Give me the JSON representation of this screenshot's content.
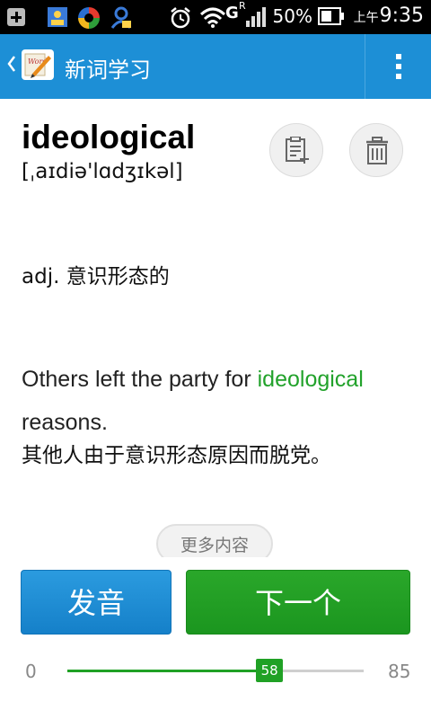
{
  "status_bar": {
    "network_label": "G",
    "roaming_label": "R",
    "battery_percent": "50%",
    "ampm": "上午",
    "time": "9:35"
  },
  "app_bar": {
    "title": "新词学习"
  },
  "word": {
    "headword": "ideological",
    "phonetic": "[ˌaɪdiə'lɑdʒɪkəl]",
    "definition": "adj. 意识形态的",
    "example_before": "Others left the party for ",
    "example_highlight": "ideological",
    "example_after": " reasons.",
    "example_translation": "其他人由于意识形态原因而脱党。"
  },
  "more_button": "更多内容",
  "buttons": {
    "speak": "发音",
    "next": "下一个"
  },
  "slider": {
    "min": "0",
    "max": "85",
    "value": 58,
    "value_label": "58"
  },
  "colors": {
    "app_bar": "#1d8fd6",
    "highlight": "#22a22b",
    "speak_button": "#1a8cd4",
    "next_button": "#22a022"
  }
}
